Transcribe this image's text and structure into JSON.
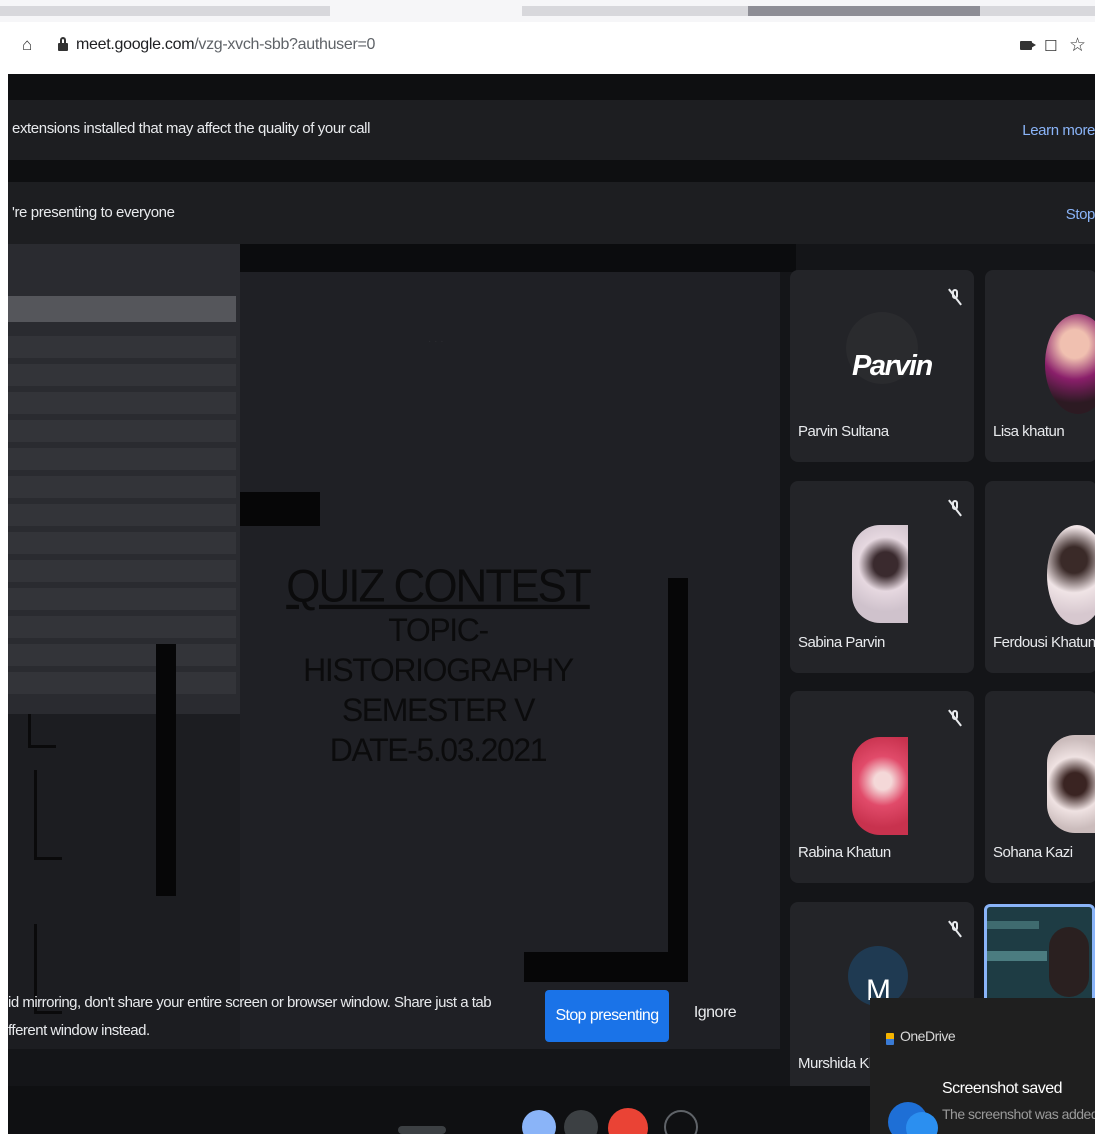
{
  "browser": {
    "url_host": "meet.google.com",
    "url_path": "/vzg-xvch-sbb?authuser=0"
  },
  "extension_banner": {
    "text": "extensions installed that may affect the quality of your call",
    "link": "Learn more"
  },
  "presenting_banner": {
    "text": "'re presenting to everyone",
    "link": "Stop"
  },
  "shared_screen": {
    "title": "QUIZ CONTEST",
    "topic": "TOPIC- HISTORIOGRAPHY",
    "semester": "SEMESTER V",
    "date": "DATE-5.03.2021"
  },
  "participants": [
    {
      "name": "Parvin Sultana",
      "avatar_text": "Parvin",
      "muted": true
    },
    {
      "name": "Lisa khatun"
    },
    {
      "name": "Sabina Parvin",
      "muted": true
    },
    {
      "name": "Ferdousi Khatun"
    },
    {
      "name": "Rabina Khatun",
      "muted": true
    },
    {
      "name": "Sohana Kazi"
    },
    {
      "name": "Murshida Kha",
      "avatar_text": "M",
      "muted": true
    }
  ],
  "mirroring_warning": {
    "line1": "id mirroring, don't share your entire screen or browser window. Share just a tab",
    "line2": "fferent window instead.",
    "stop_button": "Stop presenting",
    "ignore_button": "Ignore"
  },
  "toast": {
    "app": "OneDrive",
    "title": "Screenshot saved",
    "body": "The screenshot was added t"
  },
  "colors": {
    "accent_blue": "#1a73e8",
    "link_blue": "#8ab4f8",
    "meet_bg": "#141518",
    "tile_bg": "#232428"
  },
  "icons": [
    "home-icon",
    "lock-icon",
    "camera-icon",
    "share-icon",
    "star-icon",
    "mic-off-icon",
    "onedrive-icon",
    "cloud-icon"
  ]
}
